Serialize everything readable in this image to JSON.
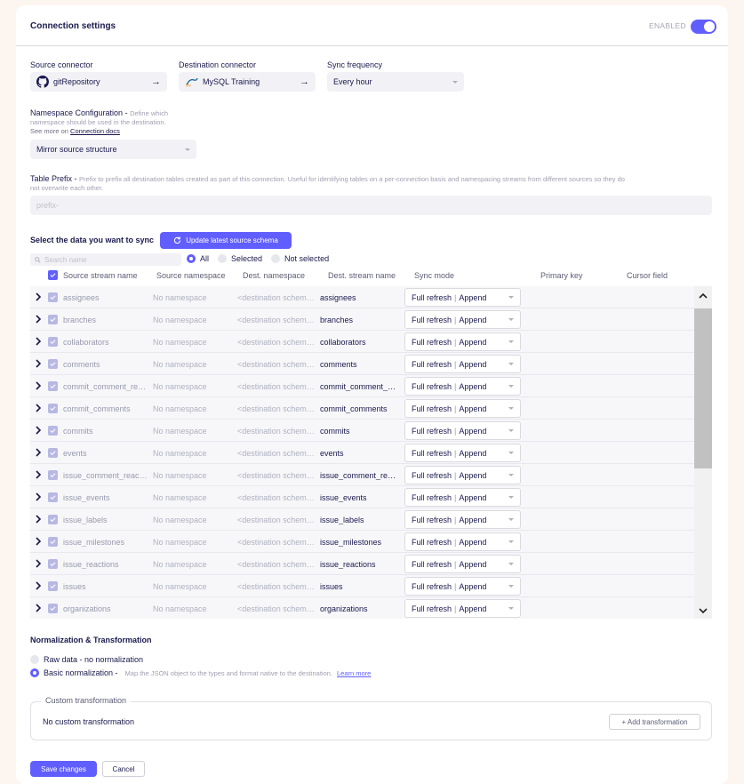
{
  "header": {
    "title": "Connection settings",
    "enabled_label": "ENABLED"
  },
  "source": {
    "label": "Source connector",
    "value": "gitRepository"
  },
  "destination": {
    "label": "Destination connector",
    "value": "MySQL Training"
  },
  "frequency": {
    "label": "Sync frequency",
    "value": "Every hour"
  },
  "namespace": {
    "title": "Namespace Configuration",
    "help_1": "Define which",
    "help_2": "namespace should be used in the destination.",
    "help_3": "See more on",
    "help_link": "Connection docs",
    "value": "Mirror source structure"
  },
  "prefix": {
    "title": "Table Prefix",
    "help": "Prefix to prefix all destination tables created as part of this connection. Useful for identifying tables on a per-connection basis and namespacing streams from different sources so they do",
    "help_2": "not overwrite each other.",
    "placeholder": "prefix-"
  },
  "sync_section": {
    "title": "Select the data you want to sync",
    "update_button": "Update latest source schema",
    "search_placeholder": "Search name",
    "filters": [
      "All",
      "Selected",
      "Not selected"
    ]
  },
  "columns": [
    "Source stream name",
    "Source namespace",
    "Dest. namespace",
    "Dest. stream name",
    "Sync mode",
    "Primary key",
    "Cursor field"
  ],
  "rows": [
    {
      "src": "assignees",
      "ns": "No namespace",
      "dns": "<destination schema>",
      "dst": "assignees",
      "mode_a": "Full refresh",
      "mode_b": "Append"
    },
    {
      "src": "branches",
      "ns": "No namespace",
      "dns": "<destination schema>",
      "dst": "branches",
      "mode_a": "Full refresh",
      "mode_b": "Append"
    },
    {
      "src": "collaborators",
      "ns": "No namespace",
      "dns": "<destination schema>",
      "dst": "collaborators",
      "mode_a": "Full refresh",
      "mode_b": "Append"
    },
    {
      "src": "comments",
      "ns": "No namespace",
      "dns": "<destination schema>",
      "dst": "comments",
      "mode_a": "Full refresh",
      "mode_b": "Append"
    },
    {
      "src": "commit_comment_reactions",
      "ns": "No namespace",
      "dns": "<destination schema>",
      "dst": "commit_comment_reactions",
      "mode_a": "Full refresh",
      "mode_b": "Append"
    },
    {
      "src": "commit_comments",
      "ns": "No namespace",
      "dns": "<destination schema>",
      "dst": "commit_comments",
      "mode_a": "Full refresh",
      "mode_b": "Append"
    },
    {
      "src": "commits",
      "ns": "No namespace",
      "dns": "<destination schema>",
      "dst": "commits",
      "mode_a": "Full refresh",
      "mode_b": "Append"
    },
    {
      "src": "events",
      "ns": "No namespace",
      "dns": "<destination schema>",
      "dst": "events",
      "mode_a": "Full refresh",
      "mode_b": "Append"
    },
    {
      "src": "issue_comment_reactions",
      "ns": "No namespace",
      "dns": "<destination schema>",
      "dst": "issue_comment_reactions",
      "mode_a": "Full refresh",
      "mode_b": "Append"
    },
    {
      "src": "issue_events",
      "ns": "No namespace",
      "dns": "<destination schema>",
      "dst": "issue_events",
      "mode_a": "Full refresh",
      "mode_b": "Append"
    },
    {
      "src": "issue_labels",
      "ns": "No namespace",
      "dns": "<destination schema>",
      "dst": "issue_labels",
      "mode_a": "Full refresh",
      "mode_b": "Append"
    },
    {
      "src": "issue_milestones",
      "ns": "No namespace",
      "dns": "<destination schema>",
      "dst": "issue_milestones",
      "mode_a": "Full refresh",
      "mode_b": "Append"
    },
    {
      "src": "issue_reactions",
      "ns": "No namespace",
      "dns": "<destination schema>",
      "dst": "issue_reactions",
      "mode_a": "Full refresh",
      "mode_b": "Append"
    },
    {
      "src": "issues",
      "ns": "No namespace",
      "dns": "<destination schema>",
      "dst": "issues",
      "mode_a": "Full refresh",
      "mode_b": "Append"
    },
    {
      "src": "organizations",
      "ns": "No namespace",
      "dns": "<destination schema>",
      "dst": "organizations",
      "mode_a": "Full refresh",
      "mode_b": "Append"
    }
  ],
  "normalization": {
    "title": "Normalization & Transformation",
    "raw_label": "Raw data - no normalization",
    "basic_label": "Basic normalization -",
    "basic_desc": "Map the JSON object to the types and format native to the destination.",
    "learn_more": "Learn more"
  },
  "custom": {
    "legend": "Custom transformation",
    "text": "No custom transformation",
    "add_button": "+ Add transformation"
  },
  "footer": {
    "save": "Save changes",
    "cancel": "Cancel"
  },
  "colors": {
    "accent": "#615eff",
    "text": "#1a194d",
    "muted": "#a0a0b3"
  }
}
